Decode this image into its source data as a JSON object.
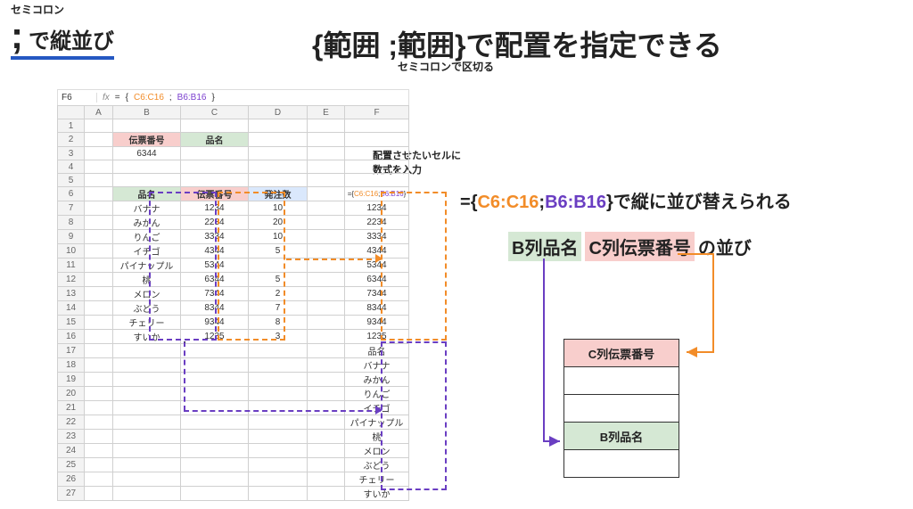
{
  "top": {
    "semicolon_label": "セミコロン",
    "semicolon": ";",
    "tate": "で縦並び",
    "headline": "{範囲 ;範囲}で配置を指定できる",
    "sub": "セミコロンで区切る"
  },
  "fx": {
    "cellref": "F6",
    "prefix": "=",
    "brace_open": "{",
    "range1": "C6:C16",
    "sep": ";",
    "range2": "B6:B16",
    "brace_close": "}"
  },
  "note1a": "配置させたいセルに",
  "note1b": "数式を入力",
  "cols": [
    "A",
    "B",
    "C",
    "D",
    "E",
    "F"
  ],
  "rows": [
    "1",
    "2",
    "3",
    "4",
    "5",
    "6",
    "7",
    "8",
    "9",
    "10",
    "11",
    "12",
    "13",
    "14",
    "15",
    "16",
    "17",
    "18",
    "19",
    "20",
    "21",
    "22",
    "23",
    "24",
    "25",
    "26",
    "27"
  ],
  "small_header": {
    "denpyo": "伝票番号",
    "hinmei": "品名",
    "val": "6344"
  },
  "table_header": {
    "hinmei": "品名",
    "denpyo": "伝票番号",
    "hachu": "発注数"
  },
  "products": [
    {
      "name": "バナナ",
      "code": "1234",
      "qty": "10"
    },
    {
      "name": "みかん",
      "code": "2234",
      "qty": "20"
    },
    {
      "name": "りんご",
      "code": "3334",
      "qty": "10"
    },
    {
      "name": "イチゴ",
      "code": "4344",
      "qty": "5"
    },
    {
      "name": "パイナップル",
      "code": "5344",
      "qty": ""
    },
    {
      "name": "桃",
      "code": "6344",
      "qty": "5"
    },
    {
      "name": "メロン",
      "code": "7344",
      "qty": "2"
    },
    {
      "name": "ぶどう",
      "code": "8344",
      "qty": "7"
    },
    {
      "name": "チェリー",
      "code": "9344",
      "qty": "8"
    },
    {
      "name": "すいか",
      "code": "1235",
      "qty": "3"
    }
  ],
  "f_top": [
    "1234",
    "2234",
    "3334",
    "4344",
    "5344",
    "6344",
    "7344",
    "8344",
    "9344",
    "1235"
  ],
  "f_bottom": [
    "品名",
    "バナナ",
    "みかん",
    "りんご",
    "イチゴ",
    "パイナップル",
    "桃",
    "メロン",
    "ぶどう",
    "チェリー",
    "すいか"
  ],
  "right": {
    "formula_prefix": "=",
    "brace_open": "{",
    "r1": "C6:C16",
    "sep": ";",
    "r2": "B6:B16",
    "brace_close": "}",
    "suffix": "で縦に並び替えられる",
    "chip_b": "B列品名",
    "chip_c": "C列伝票番号",
    "chip_suffix": " の並び",
    "box_c": "C列伝票番号",
    "box_b": "B列品名"
  }
}
